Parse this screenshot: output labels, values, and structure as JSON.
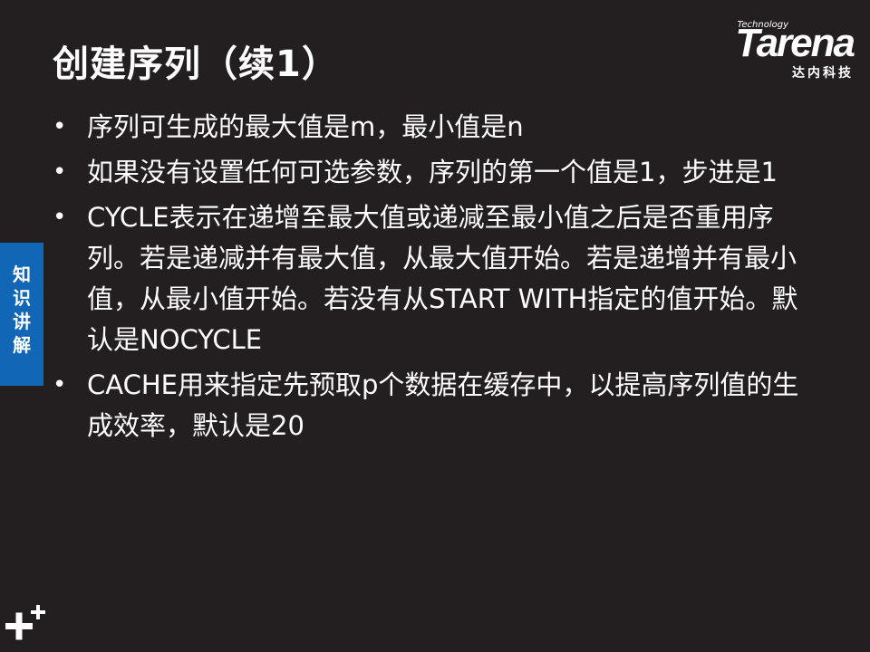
{
  "slide": {
    "title": "创建序列（续1）",
    "bullets": [
      "序列可生成的最大值是m，最小值是n",
      "如果没有设置任何可选参数，序列的第一个值是1，步进是1",
      "CYCLE表示在递增至最大值或递减至最小值之后是否重用序列。若是递减并有最大值，从最大值开始。若是递增并有最小值，从最小值开始。若没有从START WITH指定的值开始。默认是NOCYCLE",
      "CACHE用来指定先预取p个数据在缓存中，以提高序列值的生成效率，默认是20"
    ],
    "bullet_symbol": "•"
  },
  "logo": {
    "technology": "Technology",
    "brand": "Tarena",
    "chinese": "达内科技"
  },
  "side_tab": {
    "label": "知识讲解"
  },
  "colors": {
    "background": "#231f20",
    "side_tab": "#1166b5",
    "text": "#ffffff"
  },
  "icons": [
    "plus-plus-icon"
  ]
}
